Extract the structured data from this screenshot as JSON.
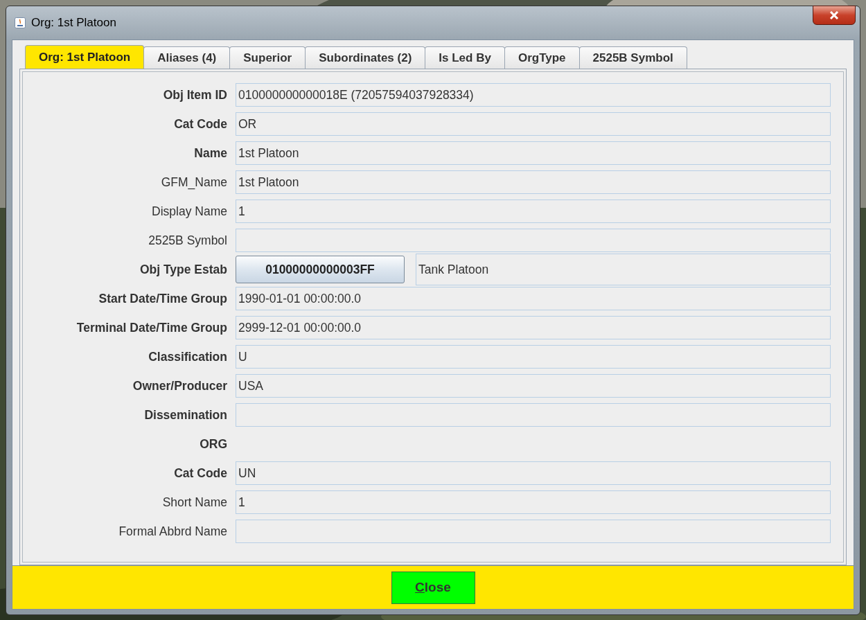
{
  "window": {
    "title": "Org: 1st Platoon"
  },
  "tabs": [
    {
      "label": "Org: 1st Platoon",
      "selected": true
    },
    {
      "label": "Aliases (4)",
      "selected": false
    },
    {
      "label": "Superior",
      "selected": false
    },
    {
      "label": "Subordinates (2)",
      "selected": false
    },
    {
      "label": "Is Led By",
      "selected": false
    },
    {
      "label": "OrgType",
      "selected": false
    },
    {
      "label": "2525B Symbol",
      "selected": false
    }
  ],
  "rows": [
    {
      "kind": "field",
      "label": "Obj Item ID",
      "bold": true,
      "value": "010000000000018E (72057594037928334)"
    },
    {
      "kind": "field",
      "label": "Cat Code",
      "bold": true,
      "value": "OR"
    },
    {
      "kind": "field",
      "label": "Name",
      "bold": true,
      "value": "1st Platoon"
    },
    {
      "kind": "field",
      "label": "GFM_Name",
      "bold": false,
      "value": "1st Platoon"
    },
    {
      "kind": "field",
      "label": "Display Name",
      "bold": false,
      "value": "1"
    },
    {
      "kind": "field",
      "label": "2525B Symbol",
      "bold": false
    },
    {
      "kind": "button",
      "label": "Obj Type Estab",
      "bold": true,
      "button": "01000000000003FF",
      "value": "Tank Platoon"
    },
    {
      "kind": "field",
      "label": "Start Date/Time Group",
      "bold": true,
      "value": "1990-01-01 00:00:00.0"
    },
    {
      "kind": "field",
      "label": "Terminal Date/Time Group",
      "bold": true,
      "value": "2999-12-01 00:00:00.0"
    },
    {
      "kind": "field",
      "label": "Classification",
      "bold": true,
      "value": "U"
    },
    {
      "kind": "field",
      "label": "Owner/Producer",
      "bold": true,
      "value": "USA"
    },
    {
      "kind": "field",
      "label": "Dissemination",
      "bold": true
    },
    {
      "kind": "heading",
      "label": "ORG",
      "bold": true
    },
    {
      "kind": "field",
      "label": "Cat Code",
      "bold": true,
      "value": "UN"
    },
    {
      "kind": "field",
      "label": "Short Name",
      "bold": false,
      "value": "1"
    },
    {
      "kind": "field",
      "label": "Formal Abbrd Name",
      "bold": false
    }
  ],
  "footer": {
    "button": {
      "label": "Close",
      "underline_first": true
    }
  }
}
